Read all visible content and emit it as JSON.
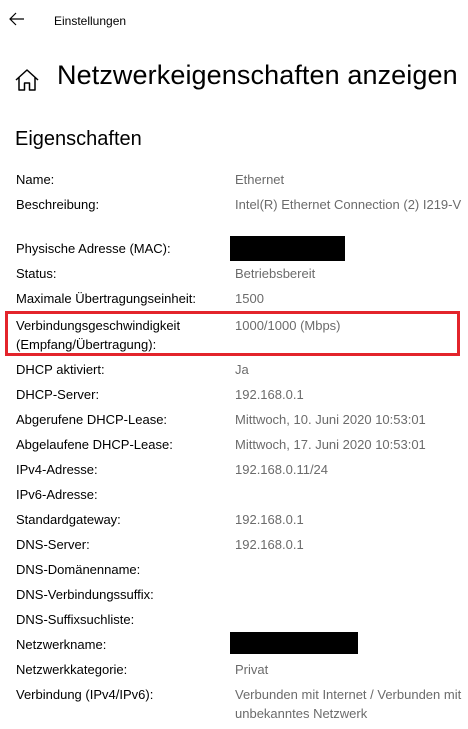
{
  "window": {
    "title": "Einstellungen"
  },
  "header": {
    "title": "Netzwerkeigenschaften anzeigen"
  },
  "section": {
    "title": "Eigenschaften"
  },
  "icons": {
    "back": "arrow-left-icon",
    "home": "home-icon"
  },
  "highlight_color": "#e3242b",
  "properties": [
    {
      "label": "Name:",
      "value": "Ethernet"
    },
    {
      "label": "Beschreibung:",
      "value": "Intel(R) Ethernet Connection (2) I219-V"
    },
    {
      "label": "Physische Adresse (MAC):",
      "value": "",
      "redacted": true
    },
    {
      "label": "Status:",
      "value": "Betriebsbereit"
    },
    {
      "label": "Maximale Übertragungseinheit:",
      "value": "1500"
    },
    {
      "label": "Verbindungsgeschwindigkeit (Empfang/Übertragung):",
      "value": "1000/1000 (Mbps)",
      "highlighted": true
    },
    {
      "label": "DHCP aktiviert:",
      "value": "Ja"
    },
    {
      "label": "DHCP-Server:",
      "value": "192.168.0.1"
    },
    {
      "label": "Abgerufene DHCP-Lease:",
      "value": "Mittwoch, 10. Juni 2020 10:53:01"
    },
    {
      "label": "Abgelaufene DHCP-Lease:",
      "value": "Mittwoch, 17. Juni 2020 10:53:01"
    },
    {
      "label": "IPv4-Adresse:",
      "value": "192.168.0.11/24"
    },
    {
      "label": "IPv6-Adresse:",
      "value": ""
    },
    {
      "label": "Standardgateway:",
      "value": "192.168.0.1"
    },
    {
      "label": "DNS-Server:",
      "value": "192.168.0.1"
    },
    {
      "label": "DNS-Domänenname:",
      "value": ""
    },
    {
      "label": "DNS-Verbindungssuffix:",
      "value": ""
    },
    {
      "label": "DNS-Suffixsuchliste:",
      "value": ""
    },
    {
      "label": "Netzwerkname:",
      "value": "",
      "redacted": true
    },
    {
      "label": "Netzwerkkategorie:",
      "value": "Privat"
    },
    {
      "label": "Verbindung (IPv4/IPv6):",
      "value": "Verbunden mit Internet / Verbunden mit unbekanntes Netzwerk"
    }
  ]
}
